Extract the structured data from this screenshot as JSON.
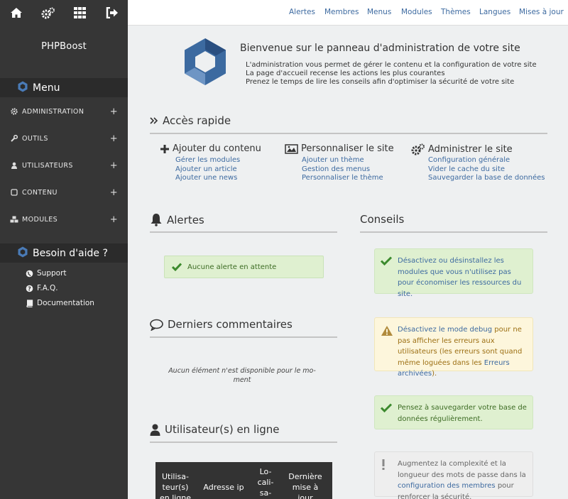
{
  "sidebar": {
    "top_icons": [
      "home-icon",
      "cogs-icon",
      "grid-icon",
      "sign-out-icon"
    ],
    "brand": "PHPBoost",
    "menu_title": "Menu",
    "items": [
      {
        "label": "ADMINISTRATION",
        "icon": "cog-icon"
      },
      {
        "label": "OUTILS",
        "icon": "wrench-icon"
      },
      {
        "label": "UTILISATEURS",
        "icon": "user-icon"
      },
      {
        "label": "CONTENU",
        "icon": "square-icon"
      },
      {
        "label": "MODULES",
        "icon": "cubes-icon"
      }
    ],
    "plus": "+",
    "help_title": "Besoin d'aide ?",
    "help_items": [
      {
        "label": "Support",
        "icon": "globe-icon"
      },
      {
        "label": "F.A.Q.",
        "icon": "question-icon"
      },
      {
        "label": "Documentation",
        "icon": "book-icon"
      }
    ]
  },
  "topbar": [
    "Alertes",
    "Membres",
    "Menus",
    "Modules",
    "Thèmes",
    "Langues",
    "Mises à jour"
  ],
  "welcome": {
    "title": "Bienvenue sur le panneau d'administration de votre site",
    "lines": [
      "L'administration vous permet de gérer le contenu et la configuration de votre site",
      "La page d'accueil recense les actions les plus courantes",
      "Prenez le temps de lire les conseils afin d'optimiser la sécurité de votre site"
    ]
  },
  "quick_access": {
    "title": "Accès rapide",
    "groups": [
      {
        "title": "Ajouter du contenu",
        "icon": "plus-icon",
        "links": [
          "Gérer les modules",
          "Ajouter un article",
          "Ajouter une news"
        ]
      },
      {
        "title": "Personnaliser le site",
        "icon": "picture-icon",
        "links": [
          "Ajouter un thème",
          "Gestion des menus",
          "Personnaliser le thème"
        ]
      },
      {
        "title": "Administrer le site",
        "icon": "cogs-icon",
        "links": [
          "Configuration générale",
          "Vider le cache du site",
          "Sauvegarder la base de données"
        ]
      }
    ]
  },
  "alerts": {
    "title": "Alertes",
    "message": "Aucune alerte en attente"
  },
  "comments": {
    "title": "Derniers commentaires",
    "empty_line1": "Aucun élément n'est disponible pour le mo-",
    "empty_line2": "ment"
  },
  "online": {
    "title": "Utilisateur(s) en ligne",
    "columns": [
      [
        "Utilisa-",
        "teur(s)",
        "en ligne"
      ],
      [
        "Adresse ip"
      ],
      [
        "Lo-",
        "cali-",
        "sa-"
      ],
      [
        "Dernière",
        "mise à",
        "jour"
      ]
    ]
  },
  "tips": {
    "title": "Conseils",
    "tip1": "Désactivez ou désinstallez les modules que vous n'utilisez pas pour économiser les ressources du site.",
    "tip2_link1": "Désactivez le mode debug",
    "tip2_text1": " pour ne pas afficher les erreurs aux utilisateurs (les erreurs sont quand même loguées dans les ",
    "tip2_link2": "Erreurs archivées",
    "tip2_text2": ").",
    "tip3": "Pensez à sauvegarder votre base de données régulièrement.",
    "tip4_text1": "Augmentez la complexité et la longueur des mots de passe dans la ",
    "tip4_link": "configuration des membres",
    "tip4_text2": " pour renforcer la sécurité."
  },
  "colors": {
    "sidebar": "#363636",
    "link": "#3d6aa0",
    "success": "#dff0d0",
    "warning": "#fdf6dc"
  }
}
